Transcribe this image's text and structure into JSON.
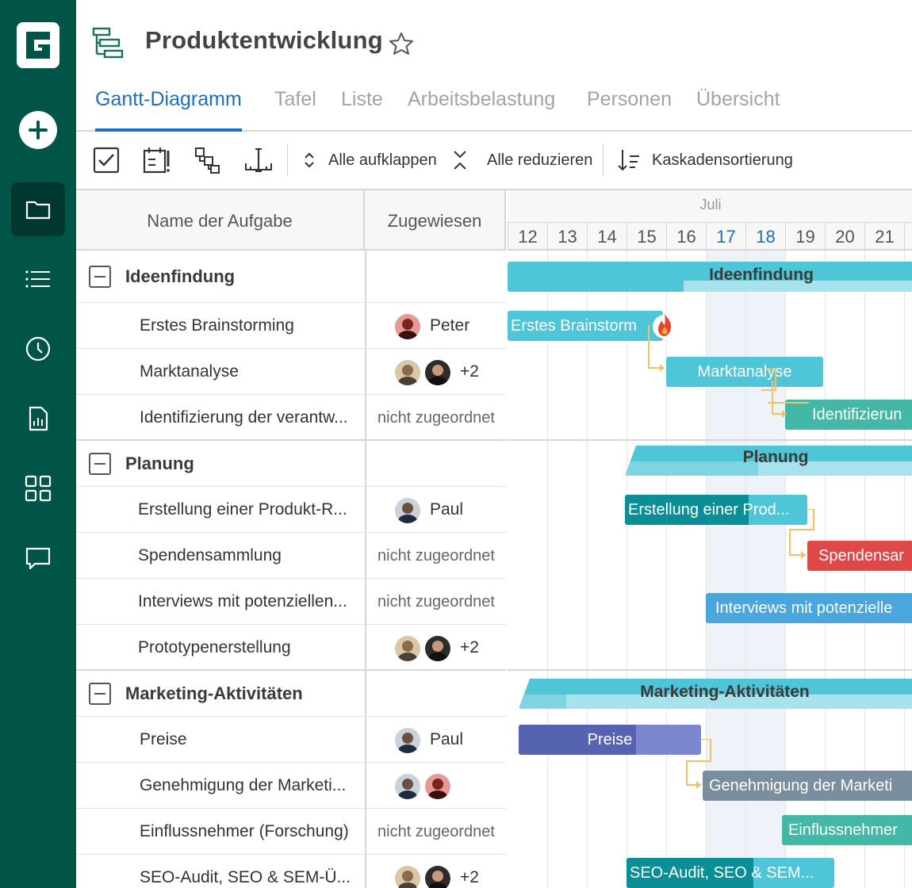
{
  "app": {
    "project_title": "Produktentwicklung",
    "tabs": [
      "Gantt-Diagramm",
      "Tafel",
      "Liste",
      "Arbeitsbelastung",
      "Personen",
      "Übersicht"
    ],
    "active_tab": "Gantt-Diagramm"
  },
  "toolbar": {
    "expand_all": "Alle aufklappen",
    "collapse_all": "Alle reduzieren",
    "cascade_sort": "Kaskadensortierung"
  },
  "grid": {
    "col_name": "Name der Aufgabe",
    "col_assigned": "Zugewiesen"
  },
  "timeline": {
    "month": "Juli",
    "days": [
      "12",
      "13",
      "14",
      "15",
      "16",
      "17",
      "18",
      "19",
      "20",
      "21"
    ],
    "highlighted_days": [
      "17",
      "18"
    ]
  },
  "groups": [
    {
      "name": "Ideenfindung",
      "tasks": [
        {
          "name": "Erstes Brainstorming",
          "assigned": "Peter",
          "bar": "Erstes Brainstorm"
        },
        {
          "name": "Marktanalyse",
          "assigned": "+2",
          "bar": "Marktanalyse"
        },
        {
          "name": "Identifizierung der verantw...",
          "assigned": "nicht zugeordnet",
          "bar": "Identifizierun"
        }
      ]
    },
    {
      "name": "Planung",
      "tasks": [
        {
          "name": "Erstellung einer Produkt-R...",
          "assigned": "Paul",
          "bar": "Erstellung einer Prod..."
        },
        {
          "name": "Spendensammlung",
          "assigned": "nicht zugeordnet",
          "bar": "Spendensar"
        },
        {
          "name": "Interviews mit potenziellen...",
          "assigned": "nicht zugeordnet",
          "bar": "Interviews mit potenzielle"
        },
        {
          "name": "Prototypenerstellung",
          "assigned": "+2",
          "bar": ""
        }
      ]
    },
    {
      "name": "Marketing-Aktivitäten",
      "tasks": [
        {
          "name": "Preise",
          "assigned": "Paul",
          "bar": "Preise"
        },
        {
          "name": "Genehmigung der Marketi...",
          "assigned": "",
          "bar": "Genehmigung der Marketi"
        },
        {
          "name": "Einflussnehmer (Forschung)",
          "assigned": "nicht zugeordnet",
          "bar": "Einflussnehmer"
        },
        {
          "name": "SEO-Audit, SEO & SEM-Ü...",
          "assigned": "+2",
          "bar": "SEO-Audit, SEO & SEM..."
        }
      ]
    }
  ],
  "colors": {
    "rail": "#005448",
    "accent": "#1e6fba",
    "bar_cyan": "#4ec6d8",
    "bar_teal": "#0a8f96",
    "bar_red": "#e04848",
    "bar_blue": "#4aa6dc",
    "bar_indigo": "#5563b0",
    "bar_slate": "#7b8e9d",
    "bar_green": "#43b8a6",
    "dependency": "#f4c06a"
  }
}
